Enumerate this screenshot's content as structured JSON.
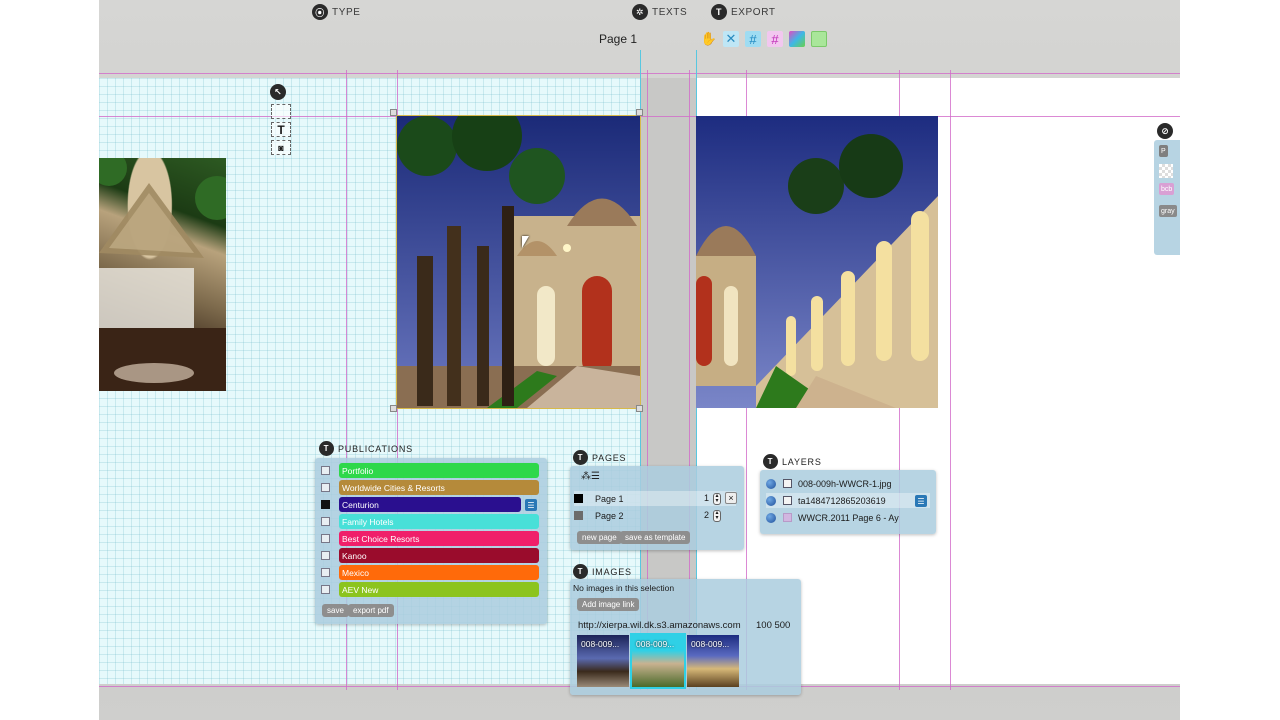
{
  "menu": {
    "type_label": "TYPE",
    "texts_label": "TEXTS",
    "export_label": "EXPORT"
  },
  "current_page": "Page 1",
  "publications": {
    "title": "PUBLICATIONS",
    "items": [
      {
        "label": "Portfolio",
        "color": "#2ed84a",
        "checked": false
      },
      {
        "label": "Worldwide Cities & Resorts",
        "color": "#b58a3a",
        "checked": false
      },
      {
        "label": "Centurion",
        "color": "#2a0f8f",
        "checked": true
      },
      {
        "label": "Family Hotels",
        "color": "#48e0d8",
        "checked": false
      },
      {
        "label": "Best Choice Resorts",
        "color": "#f01f6a",
        "checked": false
      },
      {
        "label": "Kanoo",
        "color": "#9a0c2c",
        "checked": false
      },
      {
        "label": "Mexico",
        "color": "#ff6a0a",
        "checked": false
      },
      {
        "label": "AEV New",
        "color": "#8cc41e",
        "checked": false
      }
    ],
    "save_label": "save",
    "export_label": "export pdf"
  },
  "pages": {
    "title": "PAGES",
    "rows": [
      {
        "label": "Page 1",
        "number": "1",
        "swatch": "#000000"
      },
      {
        "label": "Page 2",
        "number": "2",
        "swatch": "#6b6b6b"
      }
    ],
    "new_page_label": "new page",
    "save_template_label": "save as template"
  },
  "layers": {
    "title": "LAYERS",
    "rows": [
      {
        "label": "008-009h-WWCR-1.jpg"
      },
      {
        "label": "ta1484712865203619"
      },
      {
        "label": "WWCR.2011 Page 6 - Ay"
      }
    ]
  },
  "images": {
    "title": "IMAGES",
    "empty_text": "No images in this selection",
    "add_link_label": "Add image link",
    "url_text": "http://xierpa.wil.dk.s3.amazonaws.com",
    "size_text": "100 500",
    "thumbs": [
      {
        "label": "008-009..."
      },
      {
        "label": "008-009..."
      },
      {
        "label": "008-009..."
      }
    ]
  },
  "right_panel": {
    "chips": [
      "P",
      "bcb",
      "gray"
    ]
  }
}
